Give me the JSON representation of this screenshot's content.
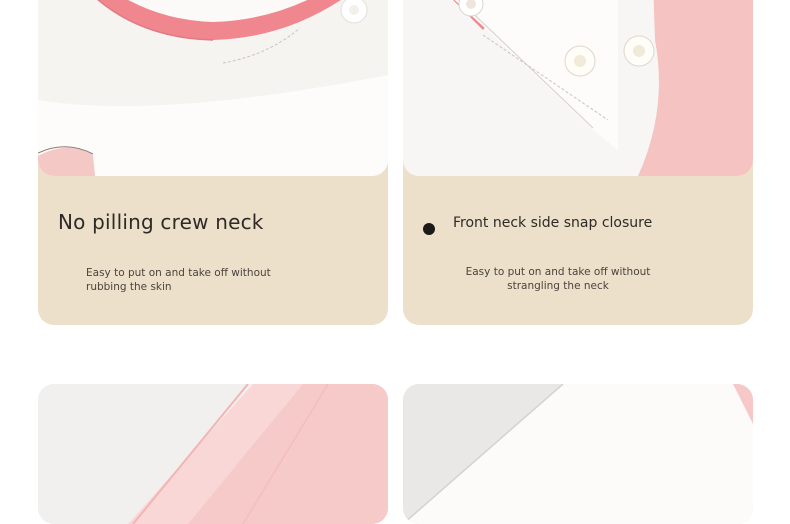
{
  "features": [
    {
      "title": "No pilling crew neck",
      "description_lines": [
        "Easy to put on and take off without",
        "rubbing the skin"
      ],
      "image": "crew-neck-closeup"
    },
    {
      "title": "Front neck side snap closure",
      "description_lines": [
        "Easy to put on and take off without",
        "strangling the neck"
      ],
      "image": "snap-closure-closeup"
    },
    {
      "image": "pink-sleeve-closeup"
    },
    {
      "image": "white-fabric-closeup"
    }
  ],
  "colors": {
    "card_background": "#ede0ca",
    "garment_pink": "#f2939a",
    "garment_white": "#fbfaf8",
    "text_primary": "#2e2a26",
    "text_secondary": "#4a443d"
  }
}
